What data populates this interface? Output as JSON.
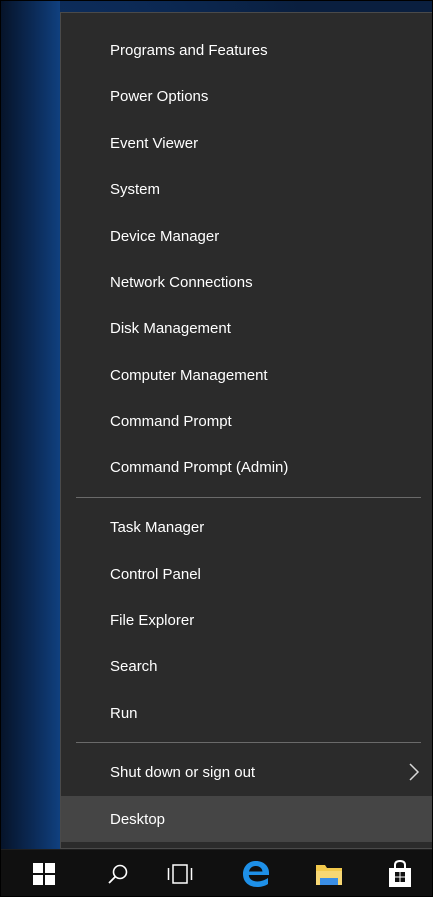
{
  "context_menu": {
    "groups": [
      {
        "items": [
          {
            "label": "Programs and Features"
          },
          {
            "label": "Power Options"
          },
          {
            "label": "Event Viewer"
          },
          {
            "label": "System"
          },
          {
            "label": "Device Manager"
          },
          {
            "label": "Network Connections"
          },
          {
            "label": "Disk Management"
          },
          {
            "label": "Computer Management"
          },
          {
            "label": "Command Prompt"
          },
          {
            "label": "Command Prompt (Admin)"
          }
        ]
      },
      {
        "items": [
          {
            "label": "Task Manager"
          },
          {
            "label": "Control Panel"
          },
          {
            "label": "File Explorer"
          },
          {
            "label": "Search"
          },
          {
            "label": "Run"
          }
        ]
      },
      {
        "items": [
          {
            "label": "Shut down or sign out",
            "submenu_icon": "chevron-right-icon"
          },
          {
            "label": "Desktop",
            "highlighted": true
          }
        ]
      }
    ]
  },
  "taskbar": {
    "buttons": [
      {
        "icon": "windows-start-icon"
      },
      {
        "icon": "search-icon"
      },
      {
        "icon": "task-view-icon"
      },
      {
        "icon": "edge-browser-icon"
      },
      {
        "icon": "file-explorer-icon"
      },
      {
        "icon": "store-icon"
      }
    ]
  },
  "colors": {
    "menu_background": "#2b2b2b",
    "menu_hover": "#454545",
    "menu_separator": "#6a6a6a",
    "menu_text": "#ffffff",
    "taskbar_background": "#101010",
    "edge_blue": "#1e90e8",
    "windows_logo": "#ffffff",
    "folder_yellow": "#f2c94c",
    "folder_blue": "#3a8ee6"
  }
}
